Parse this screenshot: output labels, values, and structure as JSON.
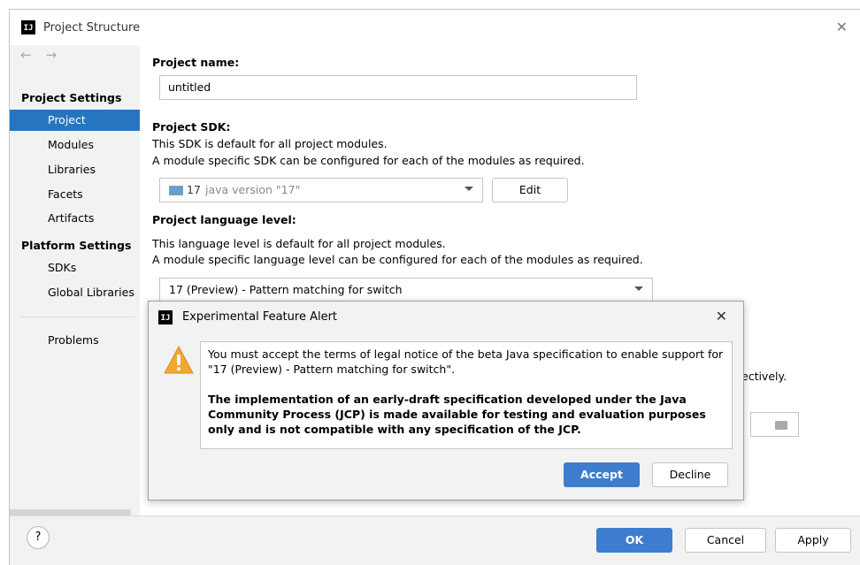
{
  "window": {
    "title": "Project Structure",
    "app_icon": "IJ"
  },
  "sidebar": {
    "nav_back": "←",
    "nav_forward": "→",
    "project_settings_header": "Project Settings",
    "items": [
      {
        "label": "Project"
      },
      {
        "label": "Modules"
      },
      {
        "label": "Libraries"
      },
      {
        "label": "Facets"
      },
      {
        "label": "Artifacts"
      }
    ],
    "platform_settings_header": "Platform Settings",
    "platform_items": [
      {
        "label": "SDKs"
      },
      {
        "label": "Global Libraries"
      }
    ],
    "problems": "Problems"
  },
  "main": {
    "project_name_label": "Project name:",
    "project_name_value": "untitled",
    "sdk_label": "Project SDK:",
    "sdk_desc1": "This SDK is default for all project modules.",
    "sdk_desc2": "A module specific SDK can be configured for each of the modules as required.",
    "sdk_version": "17",
    "sdk_detail": "java version \"17\"",
    "edit_button": "Edit",
    "language_label": "Project language level:",
    "language_desc1": "This language level is default for all project modules.",
    "language_desc2": "A module specific language level can be configured for each of the modules as required.",
    "language_value": "17 (Preview) - Pattern matching for switch",
    "partial_text": "ectively."
  },
  "dialog": {
    "title": "Experimental Feature Alert",
    "app_icon": "IJ",
    "close": "✕",
    "message1": "You must accept the terms of legal notice of the beta Java specification to enable support for \"17 (Preview) - Pattern matching for switch\".",
    "message2": "The implementation of an early-draft specification developed under the Java Community Process (JCP) is made available for testing and evaluation purposes only and is not compatible with any specification of the JCP.",
    "accept": "Accept",
    "decline": "Decline"
  },
  "footer": {
    "help": "?",
    "ok": "OK",
    "cancel": "Cancel",
    "apply": "Apply"
  },
  "colors": {
    "selection": "#2675bf",
    "primary_button": "#3d7dce",
    "warning": "#f0a832"
  }
}
